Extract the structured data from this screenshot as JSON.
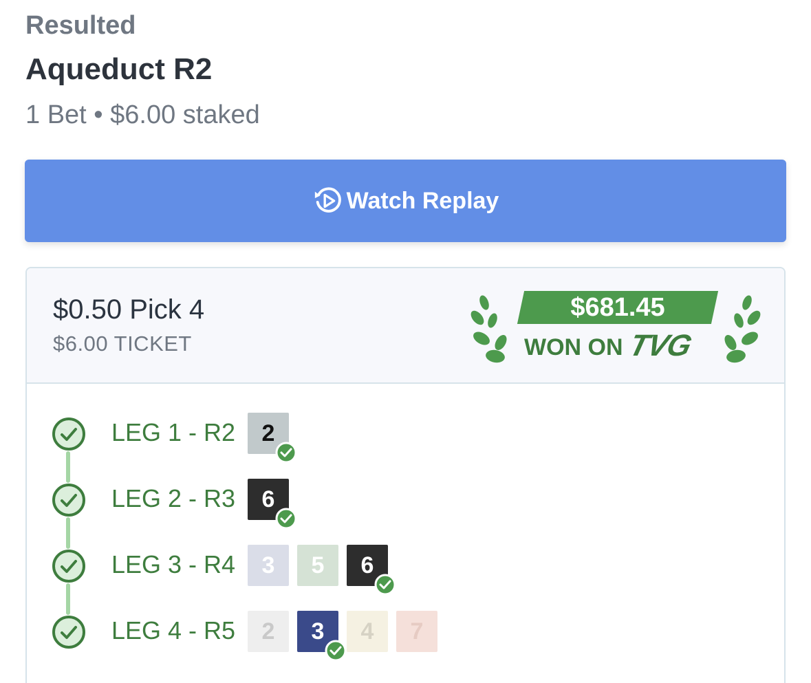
{
  "header": {
    "status": "Resulted",
    "track": "Aqueduct R2",
    "summary": "1 Bet • $6.00 staked"
  },
  "replay_button": {
    "label": "Watch Replay",
    "icon": "replay-play-icon"
  },
  "bet": {
    "type": "$0.50 Pick 4",
    "ticket": "$6.00 TICKET",
    "win_amount": "$681.45",
    "won_on": "WON ON",
    "brand": "TVG",
    "colors": {
      "win_green": "#4d9a4d",
      "leg_green": "#3e7d3e",
      "accent_blue": "#628ee6"
    },
    "legs": [
      {
        "label": "LEG 1 - R2",
        "selections": [
          {
            "number": "2",
            "bg": "#c1c9cb",
            "fg": "#111111",
            "winner": true
          }
        ]
      },
      {
        "label": "LEG 2 - R3",
        "selections": [
          {
            "number": "6",
            "bg": "#2d2d2d",
            "fg": "#ffffff",
            "winner": true
          }
        ]
      },
      {
        "label": "LEG 3 - R4",
        "selections": [
          {
            "number": "3",
            "bg": "#dadde8",
            "fg": "#ffffff",
            "winner": false
          },
          {
            "number": "5",
            "bg": "#d5e2d5",
            "fg": "#ffffff",
            "winner": false
          },
          {
            "number": "6",
            "bg": "#2d2d2d",
            "fg": "#ffffff",
            "winner": true
          }
        ]
      },
      {
        "label": "LEG 4 - R5",
        "selections": [
          {
            "number": "2",
            "bg": "#eeeeee",
            "fg": "#c9c9c9",
            "winner": false
          },
          {
            "number": "3",
            "bg": "#3a4a8a",
            "fg": "#ffffff",
            "winner": true
          },
          {
            "number": "4",
            "bg": "#f5f1e2",
            "fg": "#d6d2c4",
            "winner": false
          },
          {
            "number": "7",
            "bg": "#f5e0da",
            "fg": "#e6cbc3",
            "winner": false
          }
        ]
      }
    ]
  }
}
